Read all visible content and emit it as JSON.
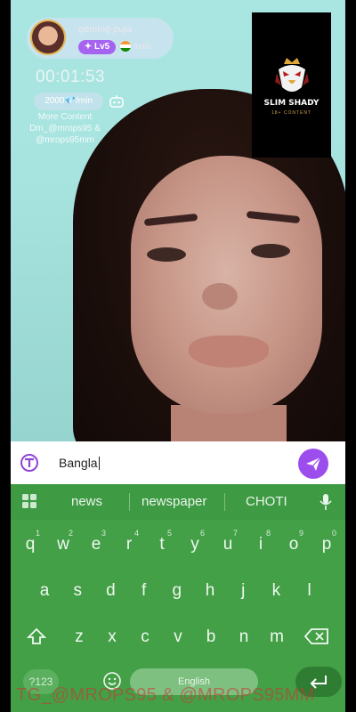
{
  "host": {
    "name": "geming puja",
    "level": "Lv5",
    "country": "India"
  },
  "call": {
    "timer": "00:01:53",
    "rate": "2000💎/min",
    "promo": "More Content Dm_@mrops95 & @mrops95mm"
  },
  "logo": {
    "title": "SLIM SHADY",
    "subtitle": "18+ CONTENT"
  },
  "message_input": {
    "value": "Bangla"
  },
  "keyboard": {
    "suggestions": [
      "news",
      "newspaper",
      "CHOTI"
    ],
    "row1": [
      {
        "k": "q",
        "h": "1"
      },
      {
        "k": "w",
        "h": "2"
      },
      {
        "k": "e",
        "h": "3"
      },
      {
        "k": "r",
        "h": "4"
      },
      {
        "k": "t",
        "h": "5"
      },
      {
        "k": "y",
        "h": "6"
      },
      {
        "k": "u",
        "h": "7"
      },
      {
        "k": "i",
        "h": "8"
      },
      {
        "k": "o",
        "h": "9"
      },
      {
        "k": "p",
        "h": "0"
      }
    ],
    "row2": [
      "a",
      "s",
      "d",
      "f",
      "g",
      "h",
      "j",
      "k",
      "l"
    ],
    "row3": [
      "z",
      "x",
      "c",
      "v",
      "b",
      "n",
      "m"
    ],
    "symbols_label": "?123",
    "space_label": "English"
  },
  "watermark": "TG_@MROPS95 & @MROPS95MM",
  "colors": {
    "keyboard_bg": "#43a047",
    "accent_purple": "#9c4ded"
  }
}
